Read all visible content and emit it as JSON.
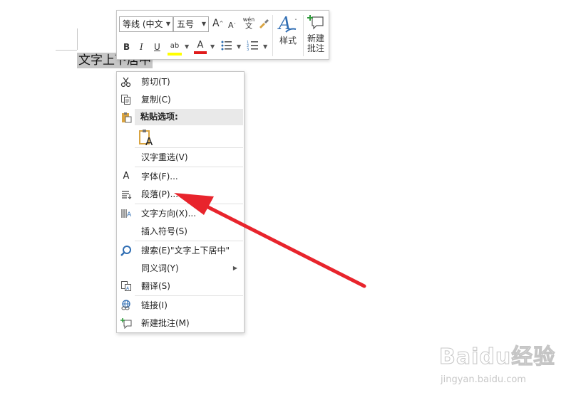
{
  "document": {
    "selected_text": "文字上下居中"
  },
  "mini_toolbar": {
    "font_name": "等线 (中文",
    "font_size": "五号",
    "grow_font_label": "A",
    "shrink_font_label": "A",
    "phonetic_top": "wén",
    "phonetic_bottom": "文",
    "bold_label": "B",
    "italic_label": "I",
    "underline_label": "U",
    "highlight_label": "ab",
    "font_color_label": "A",
    "styles_label": "样式",
    "new_comment_label_1": "新建",
    "new_comment_label_2": "批注",
    "highlight_color": "#ffff00",
    "font_color": "#e01b1b"
  },
  "context_menu": {
    "cut": "剪切(T)",
    "copy": "复制(C)",
    "paste_options": "粘贴选项:",
    "reconvert": "汉字重选(V)",
    "font": "字体(F)...",
    "paragraph": "段落(P)...",
    "text_direction": "文字方向(X)...",
    "insert_symbol": "插入符号(S)",
    "search": "搜索(E)\"文字上下居中\"",
    "synonyms": "同义词(Y)",
    "translate": "翻译(S)",
    "link": "链接(I)",
    "new_comment": "新建批注(M)"
  },
  "annotation": {
    "arrow_color": "#e8242c"
  },
  "watermark": {
    "logo": "Baidu经验",
    "url": "jingyan.baidu.com"
  }
}
